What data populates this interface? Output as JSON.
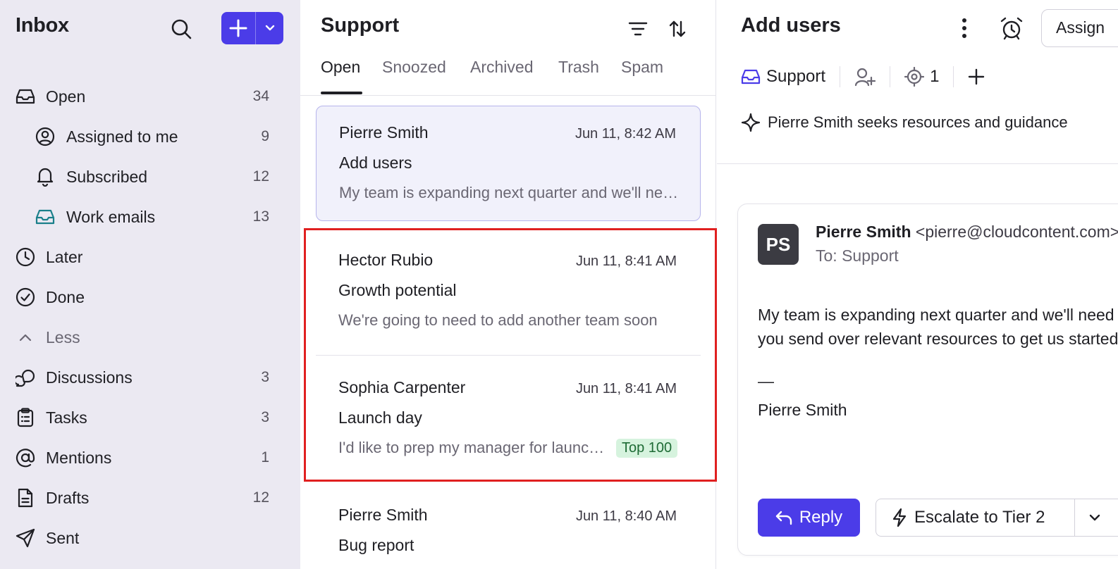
{
  "sidebar": {
    "title": "Inbox",
    "items": [
      {
        "label": "Open",
        "count": "34",
        "icon": "inbox-tray-icon"
      },
      {
        "label": "Assigned to me",
        "count": "9",
        "icon": "user-circle-icon"
      },
      {
        "label": "Subscribed",
        "count": "12",
        "icon": "bell-icon"
      },
      {
        "label": "Work emails",
        "count": "13",
        "icon": "inbox-tray-icon"
      },
      {
        "label": "Later",
        "count": "",
        "icon": "clock-icon"
      },
      {
        "label": "Done",
        "count": "",
        "icon": "check-circle-icon"
      },
      {
        "label": "Less",
        "count": "",
        "icon": "chevron-up-icon"
      },
      {
        "label": "Discussions",
        "count": "3",
        "icon": "chat-bubbles-icon"
      },
      {
        "label": "Tasks",
        "count": "3",
        "icon": "clipboard-icon"
      },
      {
        "label": "Mentions",
        "count": "1",
        "icon": "at-sign-icon"
      },
      {
        "label": "Drafts",
        "count": "12",
        "icon": "document-icon"
      },
      {
        "label": "Sent",
        "count": "",
        "icon": "paper-plane-icon"
      }
    ]
  },
  "list": {
    "title": "Support",
    "tabs": [
      "Open",
      "Snoozed",
      "Archived",
      "Trash",
      "Spam"
    ],
    "conversations": [
      {
        "from": "Pierre Smith",
        "time": "Jun 11, 8:42 AM",
        "subject": "Add users",
        "preview": "My team is expanding next quarter and we'll need to add more users",
        "tag": ""
      },
      {
        "from": "Hector Rubio",
        "time": "Jun 11, 8:41 AM",
        "subject": "Growth potential",
        "preview": "We're going to need to add another team soon",
        "tag": ""
      },
      {
        "from": "Sophia Carpenter",
        "time": "Jun 11, 8:41 AM",
        "subject": "Launch day",
        "preview": "I'd like to prep my manager for launch day",
        "tag": "Top 100"
      },
      {
        "from": "Pierre Smith",
        "time": "Jun 11, 8:40 AM",
        "subject": "Bug report",
        "preview": "",
        "tag": ""
      }
    ]
  },
  "detail": {
    "title": "Add users",
    "assign_label": "Assign",
    "inbox_label": "Support",
    "target_count": "1",
    "summary": "Pierre Smith seeks resources and guidance",
    "message": {
      "avatar_initials": "PS",
      "sender_name": "Pierre Smith",
      "sender_email": "<pierre@cloudcontent.com>",
      "to": "To: Support",
      "body_line1": "My team is expanding next quarter and we'll need to add users. Can",
      "body_line2": "you send over relevant resources to get us started?",
      "sig_dash": "—",
      "sig_name": "Pierre Smith"
    },
    "reply_label": "Reply",
    "escalate_label": "Escalate to Tier 2"
  },
  "colors": {
    "accent": "#4b3ce8",
    "sidebar_bg": "#ebe9f2",
    "selected_bg": "#f1f1fb",
    "tag_bg": "#d6f3de",
    "tag_text": "#1e6b35",
    "highlight": "#e02020"
  }
}
